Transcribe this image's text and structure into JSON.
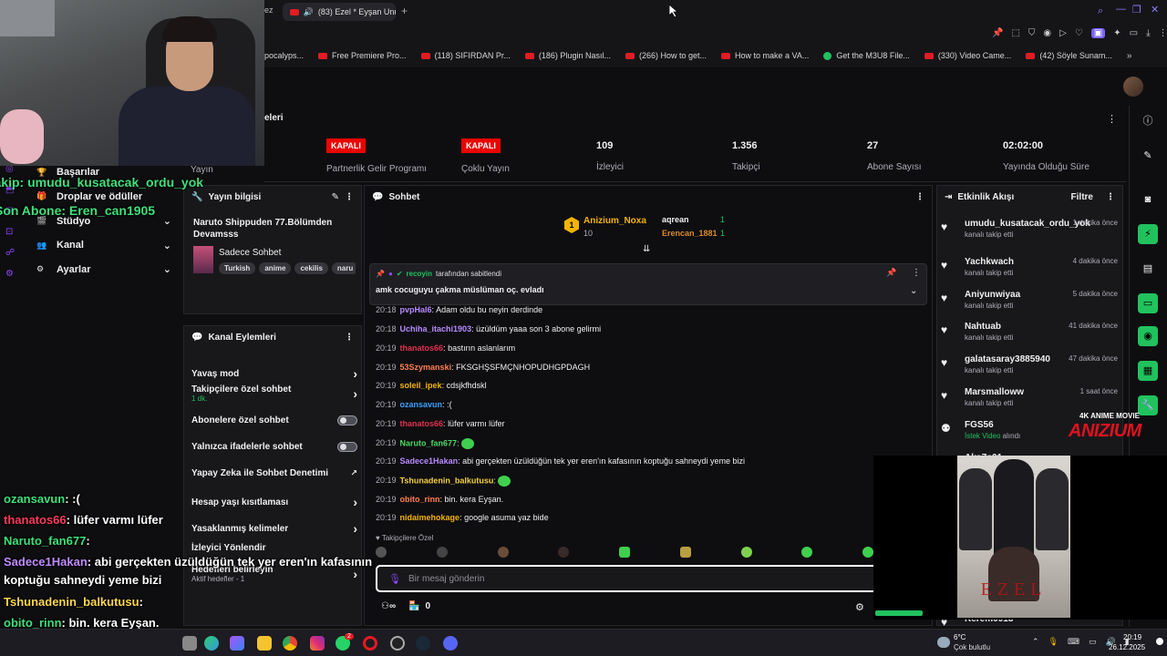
{
  "browser": {
    "tab_title": "(83) Ezel * Eyşan Unu",
    "bookmarks": [
      {
        "label": "pocalyps...",
        "icon": "none"
      },
      {
        "label": "Free Premiere Pro...",
        "icon": "youtube-icon"
      },
      {
        "label": "(118) SIFIRDAN Pr...",
        "icon": "youtube-icon"
      },
      {
        "label": "(186) Plugin Nasıl...",
        "icon": "youtube-icon"
      },
      {
        "label": "(266) How to get...",
        "icon": "youtube-icon"
      },
      {
        "label": "How to make a VA...",
        "icon": "youtube-icon"
      },
      {
        "label": "Get the M3U8 File...",
        "icon": "download-icon"
      },
      {
        "label": "(330) Video Came...",
        "icon": "youtube-icon"
      },
      {
        "label": "(42) Söyle Sunam...",
        "icon": "youtube-icon"
      }
    ]
  },
  "stats": {
    "header_label": "eleri",
    "yayin_label": "Yayın",
    "partner": {
      "badge": "KAPALI",
      "label": "Partnerlik Gelir Programı"
    },
    "multi": {
      "badge": "KAPALI",
      "label": "Çoklu Yayın"
    },
    "viewers": {
      "value": "109",
      "label": "İzleyici"
    },
    "followers": {
      "value": "1.356",
      "label": "Takipçi"
    },
    "subs": {
      "value": "27",
      "label": "Abone Sayısı"
    },
    "duration": {
      "value": "02:02:00",
      "label": "Yayında Olduğu Süre"
    }
  },
  "left_menu": {
    "items": [
      {
        "label": "Başarılar"
      },
      {
        "label": "Droplar ve ödüller"
      },
      {
        "label": "Stüdyo"
      },
      {
        "label": "Kanal"
      },
      {
        "label": "Ayarlar"
      }
    ]
  },
  "stream_info": {
    "title": "Yayın bilgisi",
    "stream_title": "Naruto Shippuden 77.Bölümden Devamsss",
    "category": "Sadece Sohbet",
    "tags": [
      "Turkish",
      "anime",
      "cekilis",
      "naru"
    ]
  },
  "channel_actions": {
    "title": "Kanal Eylemleri",
    "rows": [
      {
        "label": "Yavaş mod",
        "type": "chevron"
      },
      {
        "label": "Takipçilere özel sohbet",
        "sub": "1 dk.",
        "type": "chevron"
      },
      {
        "label": "Abonelere özel sohbet",
        "type": "toggle"
      },
      {
        "label": "Yalnızca ifadelerle sohbet",
        "type": "toggle"
      },
      {
        "label": "Yapay Zeka ile Sohbet Denetimi",
        "type": "external"
      },
      {
        "label": "Hesap yaşı kısıtlaması",
        "type": "chevron"
      },
      {
        "label": "Yasaklanmış kelimeler",
        "type": "chevron"
      },
      {
        "label": "İzleyici Yönlendir",
        "type": "none"
      },
      {
        "label": "Hedefleri belirleyin",
        "sub": "Aktif hedefler - 1",
        "type": "chevron"
      }
    ]
  },
  "chat": {
    "title": "Sohbet",
    "leaderboard": {
      "first_name": "Anizium_Noxa",
      "first_count": "10",
      "second_name": "aqrean",
      "second_count": "1",
      "third_name": "Erencan_1881",
      "third_count": "1"
    },
    "pinned": {
      "by_user": "recoyin",
      "by_text": "tarafından sabitlendi",
      "message": "amk cocuguyu çakma müslüman oç. evladı"
    },
    "messages": [
      {
        "time": "20:18",
        "user": "pvpHal6",
        "color": "#b88aff",
        "text": "Adam oldu bu neyin derdinde"
      },
      {
        "time": "20:18",
        "user": "Uchiha_itachi1903",
        "color": "#b88aff",
        "text": "üzüldüm yaaa son 3 abone gelirmi"
      },
      {
        "time": "20:19",
        "user": "thanatos66",
        "color": "#e0324f",
        "text": "bastırın aslanlarım"
      },
      {
        "time": "20:19",
        "user": "53Szymanski",
        "color": "#ff7f50",
        "text": "FKSGHŞSFMÇNHOPUDHGPDAGH"
      },
      {
        "time": "20:19",
        "user": "soleil_ipek",
        "color": "#f4b400",
        "text": "cdsjkfhdskl"
      },
      {
        "time": "20:19",
        "user": "ozansavun",
        "color": "#3aa0ff",
        "text": ":("
      },
      {
        "time": "20:19",
        "user": "thanatos66",
        "color": "#e0324f",
        "text": "lüfer varmı lüfer"
      },
      {
        "time": "20:19",
        "user": "Naruto_fan677",
        "color": "#4cd964",
        "text": ""
      },
      {
        "time": "20:19",
        "user": "Sadece1Hakan",
        "color": "#b88aff",
        "text": "abi gerçekten üzüldüğün tek yer eren'ın kafasının koptuğu sahneydi yeme bizi"
      },
      {
        "time": "20:19",
        "user": "Tshunadenin_balkutusu",
        "color": "#f4d03f",
        "text": ""
      },
      {
        "time": "20:19",
        "user": "obito_rinn",
        "color": "#ff7f50",
        "text": "bin. kera Eyşan."
      },
      {
        "time": "20:19",
        "user": "nidaimehokage",
        "color": "#f4b400",
        "text": "google asuma yaz bide"
      }
    ],
    "followers_only": "Takipçilere Özel",
    "input_placeholder": "Bir mesaj gönderin",
    "points": "0"
  },
  "activity": {
    "title": "Etkinlik Akışı",
    "filter": "Filtre",
    "items": [
      {
        "name": "umudu_kusatacak_ordu_yok",
        "desc": "kanalı takip etti",
        "when": "1 dakika önce"
      },
      {
        "name": "Yachkwach",
        "desc": "kanalı takip etti",
        "when": "4 dakika önce"
      },
      {
        "name": "Aniyunwiyaa",
        "desc": "kanalı takip etti",
        "when": "5 dakika önce"
      },
      {
        "name": "Nahtuab",
        "desc": "kanalı takip etti",
        "when": "41 dakika önce"
      },
      {
        "name": "galatasaray3885940",
        "desc": "kanalı takip etti",
        "when": "47 dakika önce"
      },
      {
        "name": "Marsmalloww",
        "desc": "kanalı takip etti",
        "when": "1 saat önce"
      },
      {
        "name": "FGS56",
        "desc_accent": "İstek Video",
        "desc": "alındı",
        "when": ""
      },
      {
        "name": "AkaZa01",
        "desc": "",
        "when": ""
      },
      {
        "name": "Kerem0913",
        "desc": "",
        "when": ""
      }
    ]
  },
  "overlay": {
    "follow_alert": "Takip: umudu_kusatacak_ordu_yok",
    "sub_alert": "Son Abone: Eren_can1905",
    "brand_small": "4K ANIME MOVIE",
    "brand_big": "ANIZIUM",
    "poster_title": "EZEL",
    "chat": [
      {
        "user": "ozansavun",
        "color": "#3fe07a",
        "text": ": :("
      },
      {
        "user": "thanatos66",
        "color": "#ff3b5c",
        "text": ": lüfer varmı lüfer"
      },
      {
        "user": "Naruto_fan677",
        "color": "#3fe07a",
        "text": ":"
      },
      {
        "user": "Sadece1Hakan",
        "color": "#c08cff",
        "text": ": abi gerçekten üzüldüğün tek yer eren'ın kafasının"
      },
      {
        "user": "",
        "color": "#ffffff",
        "text": "koptuğu sahneydi yeme bizi"
      },
      {
        "user": "Tshunadenin_balkutusu",
        "color": "#ffd84a",
        "text": ":"
      },
      {
        "user": "obito_rinn",
        "color": "#3fe07a",
        "text": ": bin. kera Eyşan."
      },
      {
        "user": "nidaimehokage",
        "color": "#ffd84a",
        "text": ": google asuma yaz bide"
      }
    ]
  },
  "taskbar": {
    "weather_temp": "6°C",
    "weather_desc": "Çok bulutlu",
    "time": "20:19",
    "date": "26.12.2025",
    "badge_count": "2"
  }
}
